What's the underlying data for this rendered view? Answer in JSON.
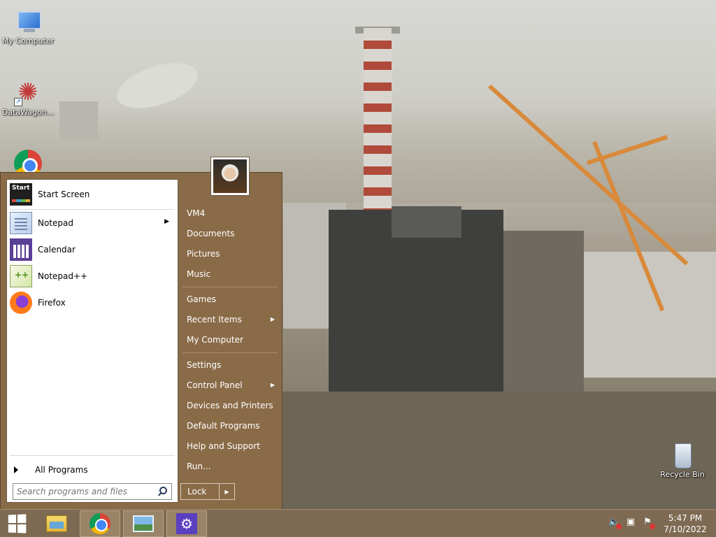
{
  "desktop": {
    "icons": [
      {
        "label": "My Computer"
      },
      {
        "label": "DataWagon..."
      },
      {
        "label": "Recycle Bin"
      }
    ]
  },
  "start_menu": {
    "programs": [
      {
        "label": "Start Screen",
        "icon": "start-screen-icon"
      },
      {
        "label": "Notepad",
        "icon": "notepad-icon",
        "has_submenu": true
      },
      {
        "label": "Calendar",
        "icon": "calendar-icon"
      },
      {
        "label": "Notepad++",
        "icon": "notepad-plus-plus-icon"
      },
      {
        "label": "Firefox",
        "icon": "firefox-icon"
      }
    ],
    "all_programs": "All Programs",
    "search_placeholder": "Search programs and files",
    "right_items": [
      {
        "label": "VM4"
      },
      {
        "label": "Documents"
      },
      {
        "label": "Pictures"
      },
      {
        "label": "Music"
      },
      {
        "label": "Games"
      },
      {
        "label": "Recent Items",
        "has_submenu": true
      },
      {
        "label": "My Computer"
      },
      {
        "label": "Settings"
      },
      {
        "label": "Control Panel",
        "has_submenu": true
      },
      {
        "label": "Devices and Printers"
      },
      {
        "label": "Default Programs"
      },
      {
        "label": "Help and Support"
      },
      {
        "label": "Run..."
      }
    ],
    "lock_label": "Lock"
  },
  "taskbar": {
    "pinned": [
      "file-explorer-icon",
      "chrome-icon",
      "photos-icon",
      "settings-icon"
    ],
    "tray": [
      "volume-muted-icon",
      "network-icon",
      "action-center-icon"
    ],
    "clock_time": "5:47 PM",
    "clock_date": "7/10/2022"
  },
  "colors": {
    "menu_background": "#8a6b48",
    "taskbar_background": "#7e6a52"
  }
}
